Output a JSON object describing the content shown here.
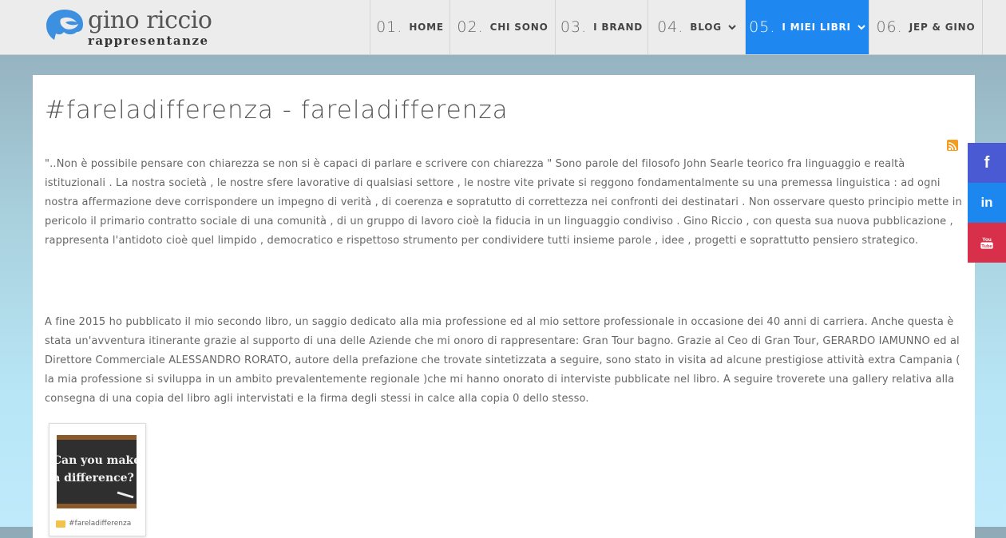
{
  "brand": {
    "name": "gino riccio",
    "tagline": "rappresentanze"
  },
  "nav": [
    {
      "num": "01.",
      "label": "HOME",
      "dropdown": false,
      "active": false
    },
    {
      "num": "02.",
      "label": "CHI SONO",
      "dropdown": false,
      "active": false
    },
    {
      "num": "03.",
      "label": "I BRAND",
      "dropdown": false,
      "active": false
    },
    {
      "num": "04.",
      "label": "BLOG",
      "dropdown": true,
      "active": false
    },
    {
      "num": "05.",
      "label": "I MIEI LIBRI",
      "dropdown": true,
      "active": true
    },
    {
      "num": "06.",
      "label": "JEP & GINO",
      "dropdown": false,
      "active": false
    }
  ],
  "page": {
    "title": "#fareladifferenza - fareladifferenza",
    "paragraphs": [
      "\"..Non è possibile pensare con chiarezza se non si è capaci di parlare e scrivere con chiarezza \" Sono parole del filosofo John Searle teorico fra linguaggio e realtà istituzionali . La nostra società , le nostre sfere lavorative di qualsiasi settore , le nostre vite private si reggono fondamentalmente su una premessa linguistica : ad ogni nostra affermazione deve corrispondere un impegno di verità , di coerenza e sopratutto di correttezza nei confronti dei destinatari . Non osservare questo principio mette in pericolo il primario contratto sociale di una comunità , di un gruppo di lavoro cioè la fiducia in un linguaggio condiviso . Gino Riccio , con questa sua nuova pubblicazione , rappresenta l'antidoto cioè quel limpido , democratico e rispettoso strumento per condividere tutti insieme parole , idee , progetti e soprattutto pensiero strategico.",
      "A fine 2015 ho pubblicato il mio secondo libro, un saggio dedicato alla mia professione ed al mio settore professionale in occasione dei 40 anni di carriera. Anche questa è stata un'avventura itinerante grazie al supporto di una delle Aziende che mi onoro di rappresentare: Gran Tour bagno. Grazie al Ceo di Gran Tour, GERARDO IAMUNNO ed al Direttore Commerciale ALESSANDRO RORATO, autore della prefazione che trovate sintetizzata a seguire, sono stato in visita ad alcune prestigiose attività extra Campania ( la mia professione si sviluppa in un ambito prevalentemente regionale )che mi hanno onorato di interviste pubblicate nel libro. A seguire troverete una gallery relativa alla consegna di una copia del libro agli intervistati e la firma degli stessi in calce alla copia 0 dello stesso."
    ],
    "gallery": {
      "image_text": [
        "Can you make",
        "a difference?"
      ],
      "caption": "#fareladifferenza"
    }
  },
  "social": [
    {
      "icon": "facebook-icon",
      "glyph": "f",
      "color": "#4a5ad3"
    },
    {
      "icon": "linkedin-icon",
      "glyph": "in",
      "color": "#1d87f0"
    },
    {
      "icon": "youtube-icon",
      "glyph": "You Tube",
      "color": "#d8304a"
    }
  ],
  "colors": {
    "accent": "#1e88f0",
    "rss": "#f39c1e"
  }
}
